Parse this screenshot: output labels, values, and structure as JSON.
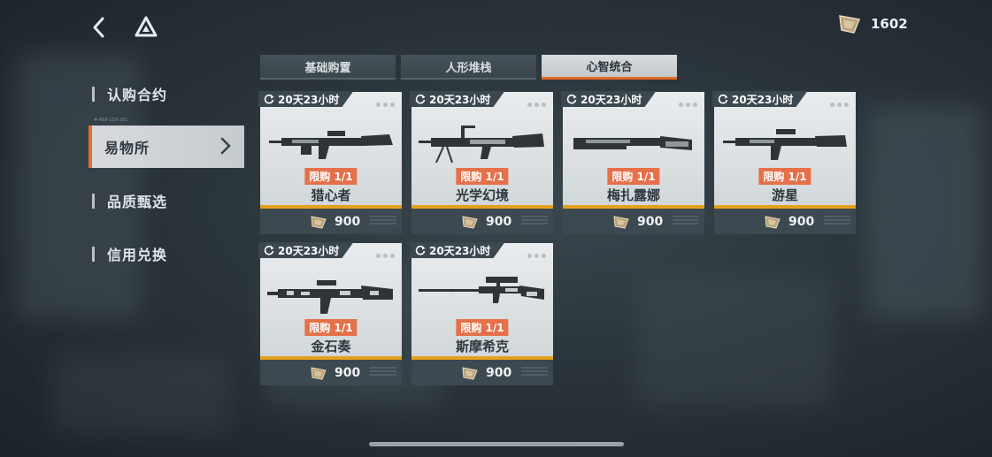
{
  "header": {
    "currency_icon": "tan-gem-icon",
    "currency_value": "1602"
  },
  "sidebar": {
    "code_text": "#-488-159-161",
    "items": [
      {
        "label": "认购合约"
      },
      {
        "label": "易物所"
      },
      {
        "label": "品质甄选"
      },
      {
        "label": "信用兑换"
      }
    ]
  },
  "tabs": [
    {
      "label": "基础购置"
    },
    {
      "label": "人形堆栈"
    },
    {
      "label": "心智统合"
    }
  ],
  "products": [
    {
      "timer": "20天23小时",
      "limit": "限购 1/1",
      "name": "猎心者",
      "price": "900"
    },
    {
      "timer": "20天23小时",
      "limit": "限购 1/1",
      "name": "光学幻境",
      "price": "900"
    },
    {
      "timer": "20天23小时",
      "limit": "限购 1/1",
      "name": "梅扎露娜",
      "price": "900"
    },
    {
      "timer": "20天23小时",
      "limit": "限购 1/1",
      "name": "游星",
      "price": "900"
    },
    {
      "timer": "20天23小时",
      "limit": "限购 1/1",
      "name": "金石奏",
      "price": "900"
    },
    {
      "timer": "20天23小时",
      "limit": "限购 1/1",
      "name": "斯摩希克",
      "price": "900"
    }
  ],
  "colors": {
    "accent": "#e2692a",
    "limit_badge": "#e5704a",
    "price_strip": "#e3a11c"
  }
}
